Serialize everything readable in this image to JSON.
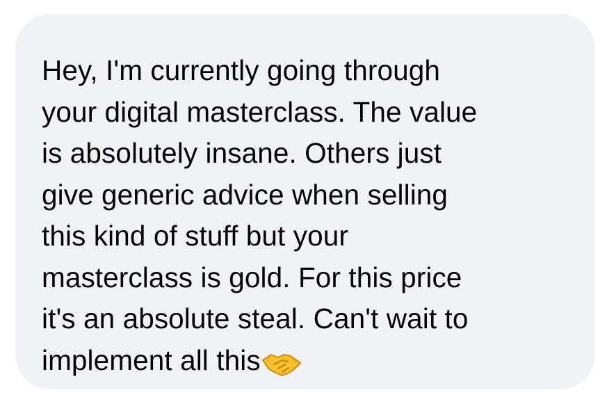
{
  "message": {
    "lines": [
      "Hey, I'm currently going through",
      "your digital masterclass. The value",
      "is absolutely insane. Others just",
      "give generic advice when selling",
      "this kind of stuff but your",
      "masterclass is gold. For this price",
      "it's an absolute steal. Can't wait to",
      "implement all this"
    ],
    "emoji": "handshake-icon"
  },
  "colors": {
    "bubble_background": "#f1f2f5",
    "text": "#050505",
    "emoji": "#f6c02d"
  }
}
